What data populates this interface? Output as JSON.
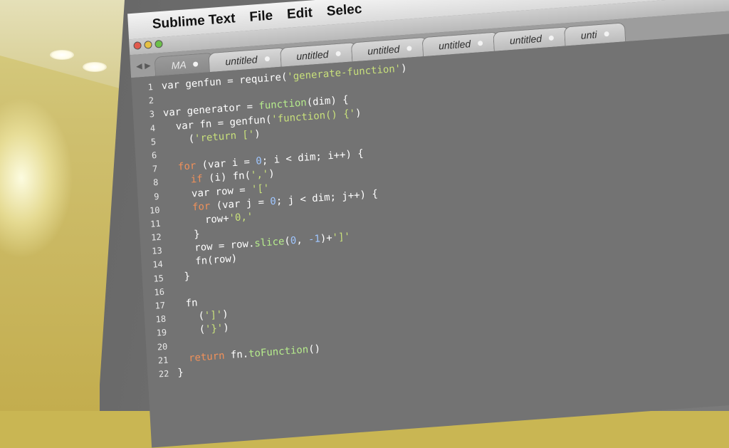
{
  "menubar": {
    "apple_icon": "apple-logo-icon",
    "app_name": "Sublime Text",
    "items": [
      "File",
      "Edit",
      "Selec"
    ]
  },
  "tabs": [
    {
      "label": "MA",
      "active": true
    },
    {
      "label": "untitled",
      "active": false
    },
    {
      "label": "untitled",
      "active": false
    },
    {
      "label": "untitled",
      "active": false
    },
    {
      "label": "untitled",
      "active": false
    },
    {
      "label": "untitled",
      "active": false
    },
    {
      "label": "unti",
      "active": false
    }
  ],
  "line_numbers": [
    "1",
    "2",
    "3",
    "4",
    "5",
    "6",
    "7",
    "8",
    "9",
    "10",
    "11",
    "12",
    "13",
    "14",
    "15",
    "16",
    "17",
    "18",
    "19",
    "20",
    "21",
    "22"
  ],
  "code_lines": [
    [
      {
        "t": "var genfun = require(",
        "c": "w"
      },
      {
        "t": "'generate-function'",
        "c": "s"
      },
      {
        "t": ")",
        "c": "w"
      }
    ],
    [],
    [
      {
        "t": "var generator = ",
        "c": "w"
      },
      {
        "t": "function",
        "c": "f"
      },
      {
        "t": "(dim) {",
        "c": "w"
      }
    ],
    [
      {
        "t": "  var fn = genfun(",
        "c": "w"
      },
      {
        "t": "'function() {'",
        "c": "s"
      },
      {
        "t": ")",
        "c": "w"
      }
    ],
    [
      {
        "t": "    (",
        "c": "w"
      },
      {
        "t": "'return ['",
        "c": "s"
      },
      {
        "t": ")",
        "c": "w"
      }
    ],
    [],
    [
      {
        "t": "  for",
        "c": "k"
      },
      {
        "t": " (var i = ",
        "c": "w"
      },
      {
        "t": "0",
        "c": "n"
      },
      {
        "t": "; i < dim; i++) {",
        "c": "w"
      }
    ],
    [
      {
        "t": "    if",
        "c": "k"
      },
      {
        "t": " (i) fn(",
        "c": "w"
      },
      {
        "t": "','",
        "c": "s"
      },
      {
        "t": ")",
        "c": "w"
      }
    ],
    [
      {
        "t": "    var row = ",
        "c": "w"
      },
      {
        "t": "'['",
        "c": "s"
      }
    ],
    [
      {
        "t": "    for",
        "c": "k"
      },
      {
        "t": " (var j = ",
        "c": "w"
      },
      {
        "t": "0",
        "c": "n"
      },
      {
        "t": "; j < dim; j++) {",
        "c": "w"
      }
    ],
    [
      {
        "t": "      row+",
        "c": "w"
      },
      {
        "t": "'0,'",
        "c": "s"
      }
    ],
    [
      {
        "t": "    }",
        "c": "w"
      }
    ],
    [
      {
        "t": "    row = row.",
        "c": "w"
      },
      {
        "t": "slice",
        "c": "f"
      },
      {
        "t": "(",
        "c": "w"
      },
      {
        "t": "0",
        "c": "n"
      },
      {
        "t": ", ",
        "c": "w"
      },
      {
        "t": "-1",
        "c": "n"
      },
      {
        "t": ")+",
        "c": "w"
      },
      {
        "t": "']'",
        "c": "s"
      }
    ],
    [
      {
        "t": "    fn(row)",
        "c": "w"
      }
    ],
    [
      {
        "t": "  }",
        "c": "w"
      }
    ],
    [],
    [
      {
        "t": "  fn",
        "c": "w"
      }
    ],
    [
      {
        "t": "    (",
        "c": "w"
      },
      {
        "t": "']'",
        "c": "s"
      },
      {
        "t": ")",
        "c": "w"
      }
    ],
    [
      {
        "t": "    (",
        "c": "w"
      },
      {
        "t": "'}'",
        "c": "s"
      },
      {
        "t": ")",
        "c": "w"
      }
    ],
    [],
    [
      {
        "t": "  return",
        "c": "k"
      },
      {
        "t": " fn.",
        "c": "w"
      },
      {
        "t": "toFunction",
        "c": "f"
      },
      {
        "t": "()",
        "c": "w"
      }
    ],
    [
      {
        "t": "}",
        "c": "w"
      }
    ]
  ]
}
